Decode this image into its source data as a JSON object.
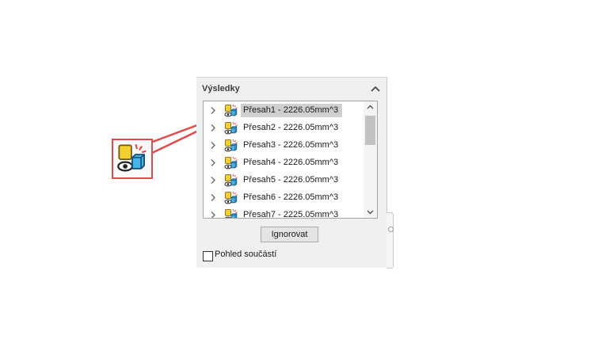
{
  "panel": {
    "title": "Výsledky",
    "ignore_button": "Ignorovat",
    "checkbox_label": "Pohled součástí"
  },
  "results": [
    {
      "label": "Přesah1 - 2226.05mm^3",
      "selected": true
    },
    {
      "label": "Přesah2 - 2226.05mm^3",
      "selected": false
    },
    {
      "label": "Přesah3 - 2226.05mm^3",
      "selected": false
    },
    {
      "label": "Přesah4 - 2226.05mm^3",
      "selected": false
    },
    {
      "label": "Přesah5 - 2226.05mm^3",
      "selected": false
    },
    {
      "label": "Přesah6 - 2226.05mm^3",
      "selected": false
    },
    {
      "label": "Přesah7 - 2225.05mm^3",
      "selected": false
    }
  ],
  "icons": {
    "row_icon": "interference-icon",
    "expand": "chevron-right-icon",
    "collapse": "chevron-up-icon",
    "scroll_up": "scroll-up-icon",
    "scroll_down": "scroll-down-icon",
    "callout": "interference-icon-enlarged"
  },
  "colors": {
    "callout": "#e04c4c",
    "selection": "#cfcfcf",
    "icon_yellow": "#f2cf2e",
    "icon_blue": "#49b3e6"
  }
}
